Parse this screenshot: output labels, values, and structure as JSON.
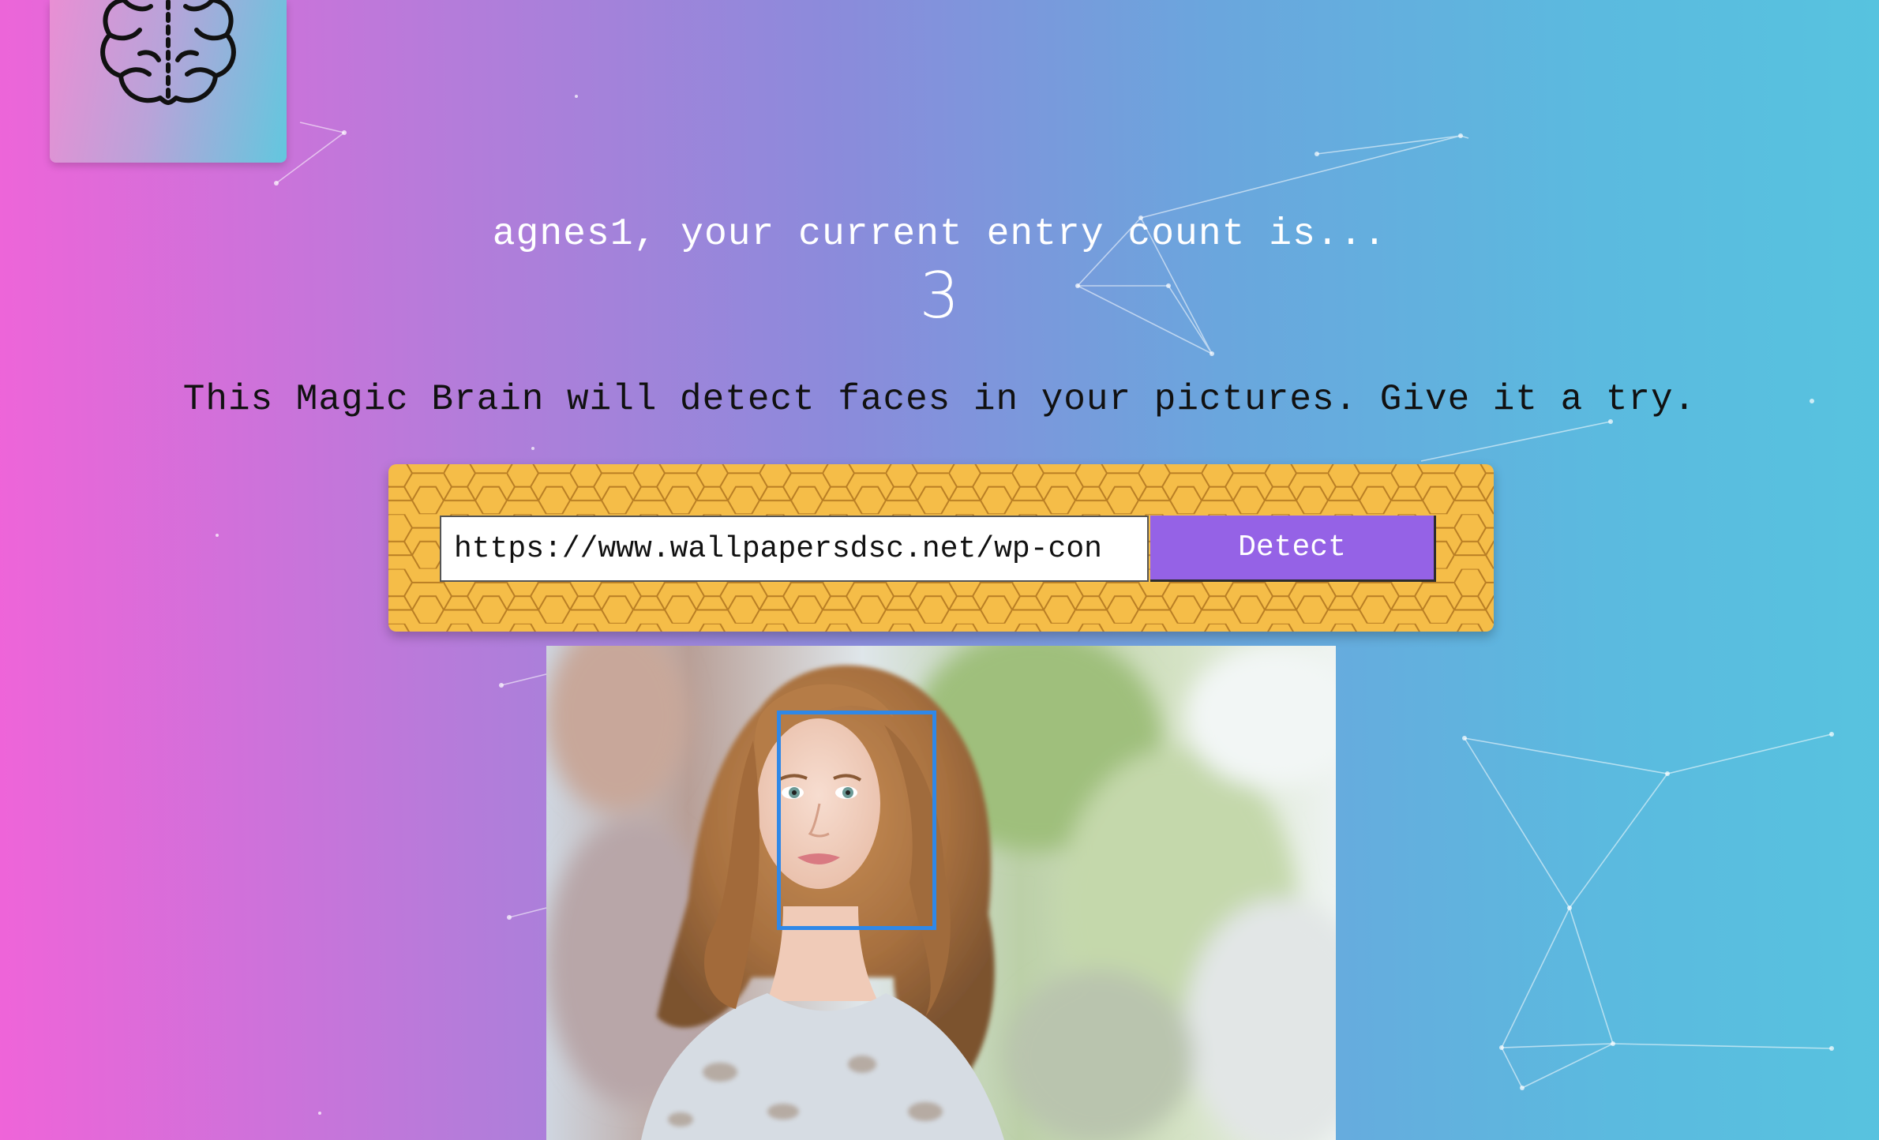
{
  "app": {
    "title": "Magic Brain"
  },
  "colors": {
    "gradient_start": "#ef64d9",
    "gradient_end": "#57c3df",
    "panel": "#f5bd48",
    "detect_button": "#9562e6",
    "face_box": "#2f88e8"
  },
  "logo": {
    "icon": "brain-icon"
  },
  "rank": {
    "greeting": "agnes1, your current entry count is...",
    "count": "3"
  },
  "intro": {
    "text": "This Magic Brain will detect faces in your pictures. Give it a try."
  },
  "form": {
    "url_value": "https://www.wallpapersdsc.net/wp-con",
    "detect_label": "Detect"
  },
  "result": {
    "image_alt": "portrait-photo",
    "faces_detected": 1
  }
}
